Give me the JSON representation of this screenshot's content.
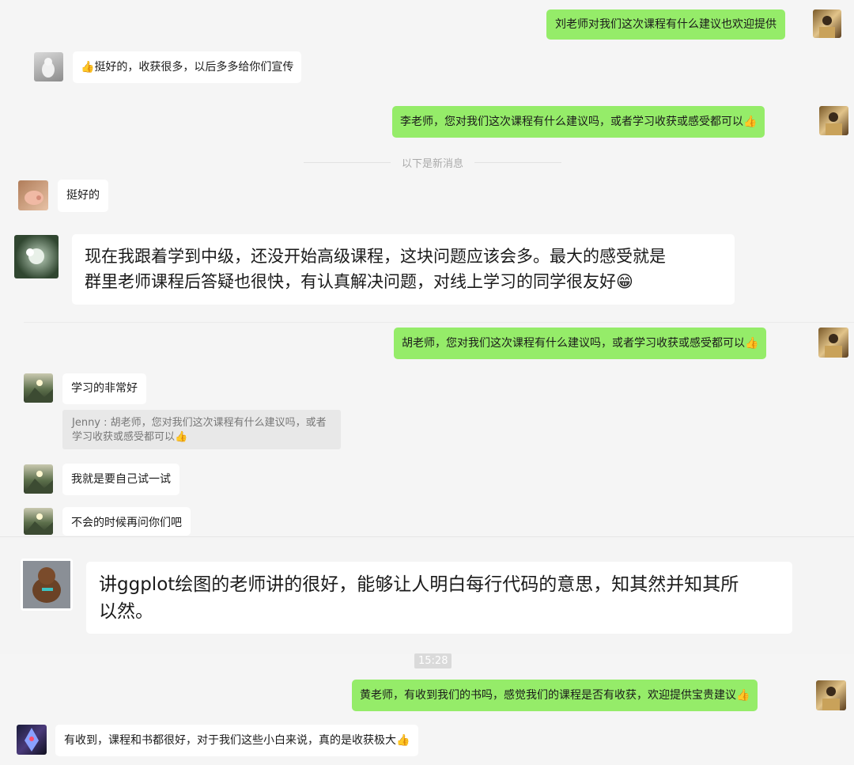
{
  "messages": [
    {
      "text": "刘老师对我们这次课程有什么建议也欢迎提供",
      "emoji": ""
    },
    {
      "text": "挺好的，收获很多，以后多多给你们宣传",
      "emoji": "👍"
    },
    {
      "text": "李老师，您对我们这次课程有什么建议吗，或者学习收获或感受都可以",
      "emoji": "👍"
    },
    {
      "text": "挺好的",
      "emoji": ""
    },
    {
      "line1": "现在我跟着学到中级，还没开始高级课程，这块问题应该会多。最大的感受就是",
      "line2": "群里老师课程后答疑也很快，有认真解决问题，对线上学习的同学很友好",
      "emoji": "😁"
    },
    {
      "text": "胡老师，您对我们这次课程有什么建议吗，或者学习收获或感受都可以",
      "emoji": "👍"
    },
    {
      "text": "学习的非常好",
      "emoji": ""
    },
    {
      "text": "我就是要自己试一试",
      "emoji": ""
    },
    {
      "text": "不会的时候再问你们吧",
      "emoji": ""
    },
    {
      "line1": "讲ggplot绘图的老师讲的很好，能够让人明白每行代码的意思，知其然并知其所",
      "line2": "以然。",
      "emoji": ""
    },
    {
      "text": "黄老师，有收到我们的书吗，感觉我们的课程是否有收获，欢迎提供宝贵建议",
      "emoji": "👍"
    },
    {
      "text": "有收到，课程和书都很好，对于我们这些小白来说，真的是收获极大",
      "emoji": "👍"
    }
  ],
  "quote": {
    "line1": "Jenny : 胡老师，您对我们这次课程有什么建议吗，或者",
    "line2": "学习收获或感受都可以",
    "emoji": "👍"
  },
  "separator": {
    "text": "以下是新消息"
  },
  "timestamp": {
    "text": "15:28"
  },
  "colors": {
    "sent_bubble": "#95ec69",
    "received_bubble": "#ffffff",
    "background": "#f5f5f5",
    "quote_bg": "#e8e8e8"
  }
}
